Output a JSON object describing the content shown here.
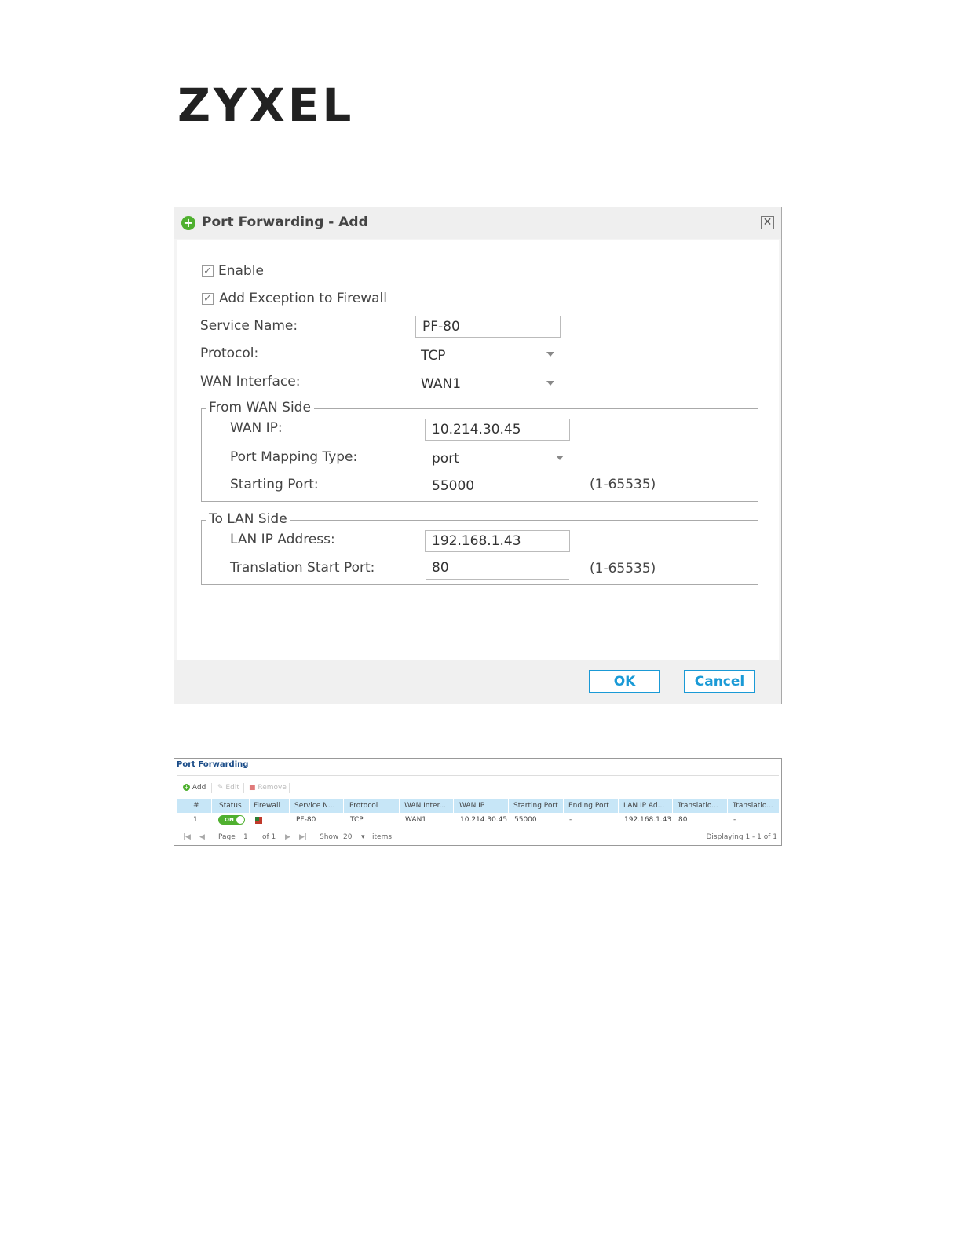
{
  "logo": "ZYXEL",
  "dialog": {
    "title": "Port Forwarding - Add",
    "enable_label": "Enable",
    "enable_checked": true,
    "exception_label": "Add Exception to Firewall",
    "exception_checked": true,
    "service_name_label": "Service Name:",
    "service_name_value": "PF-80",
    "protocol_label": "Protocol:",
    "protocol_value": "TCP",
    "wan_interface_label": "WAN Interface:",
    "wan_interface_value": "WAN1",
    "from_wan": {
      "legend": "From WAN Side",
      "wan_ip_label": "WAN IP:",
      "wan_ip_value": "10.214.30.45",
      "mapping_type_label": "Port Mapping Type:",
      "mapping_type_value": "port",
      "starting_port_label": "Starting Port:",
      "starting_port_value": "55000",
      "starting_port_range": "(1-65535)"
    },
    "to_lan": {
      "legend": "To LAN Side",
      "lan_ip_label": "LAN IP Address:",
      "lan_ip_value": "192.168.1.43",
      "translation_label": "Translation Start Port:",
      "translation_value": "80",
      "translation_range": "(1-65535)"
    },
    "ok_label": "OK",
    "cancel_label": "Cancel"
  },
  "table_panel": {
    "title": "Port Forwarding",
    "toolbar": {
      "add": "Add",
      "edit": "Edit",
      "remove": "Remove"
    },
    "columns": [
      "#",
      "Status",
      "Firewall",
      "Service N...",
      "Protocol",
      "WAN Inter...",
      "WAN IP",
      "Starting Port",
      "Ending Port",
      "LAN IP Ad...",
      "Translatio...",
      "Translatio..."
    ],
    "row": {
      "num": "1",
      "status": "ON",
      "service": "PF-80",
      "protocol": "TCP",
      "wan_interface": "WAN1",
      "wan_ip": "10.214.30.45",
      "starting_port": "55000",
      "ending_port": "-",
      "lan_ip": "192.168.1.43",
      "translation_start": "80",
      "translation_end": "-"
    },
    "pager": {
      "page_label": "Page",
      "page_value": "1",
      "of_label": "of 1",
      "show_label": "Show",
      "show_value": "20",
      "items_label": "items",
      "displaying": "Displaying 1 - 1 of 1"
    }
  },
  "colors": {
    "accent": "#1a9ad6",
    "green": "#4fb02f",
    "header_blue": "#c7e6f7"
  },
  "icons": [
    "plus-circle-icon",
    "close-icon",
    "checkbox-icon",
    "dropdown-caret-icon",
    "add-icon",
    "edit-icon",
    "remove-icon",
    "firewall-icon",
    "first-page-icon",
    "prev-page-icon",
    "next-page-icon",
    "last-page-icon"
  ]
}
